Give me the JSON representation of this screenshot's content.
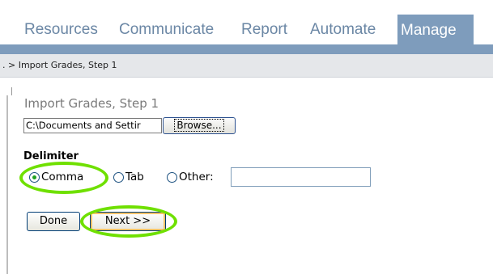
{
  "nav": {
    "tabs": [
      "Resources",
      "Communicate",
      "Report",
      "Automate"
    ],
    "active_tab": "Manage"
  },
  "breadcrumb": ". > Import Grades, Step 1",
  "page": {
    "title": "Import Grades, Step 1",
    "file_value": "C:\\Documents and Settir",
    "browse_label": "Browse...",
    "delimiter_label": "Delimiter",
    "radios": {
      "comma": "Comma",
      "tab": "Tab",
      "other": "Other:"
    },
    "comma_selected": true,
    "done_label": "Done",
    "next_label": "Next >>"
  },
  "colors": {
    "tab_text": "#6b87a5",
    "tab_active_bg": "#7e9cbc",
    "highlight": "#6fe000"
  }
}
